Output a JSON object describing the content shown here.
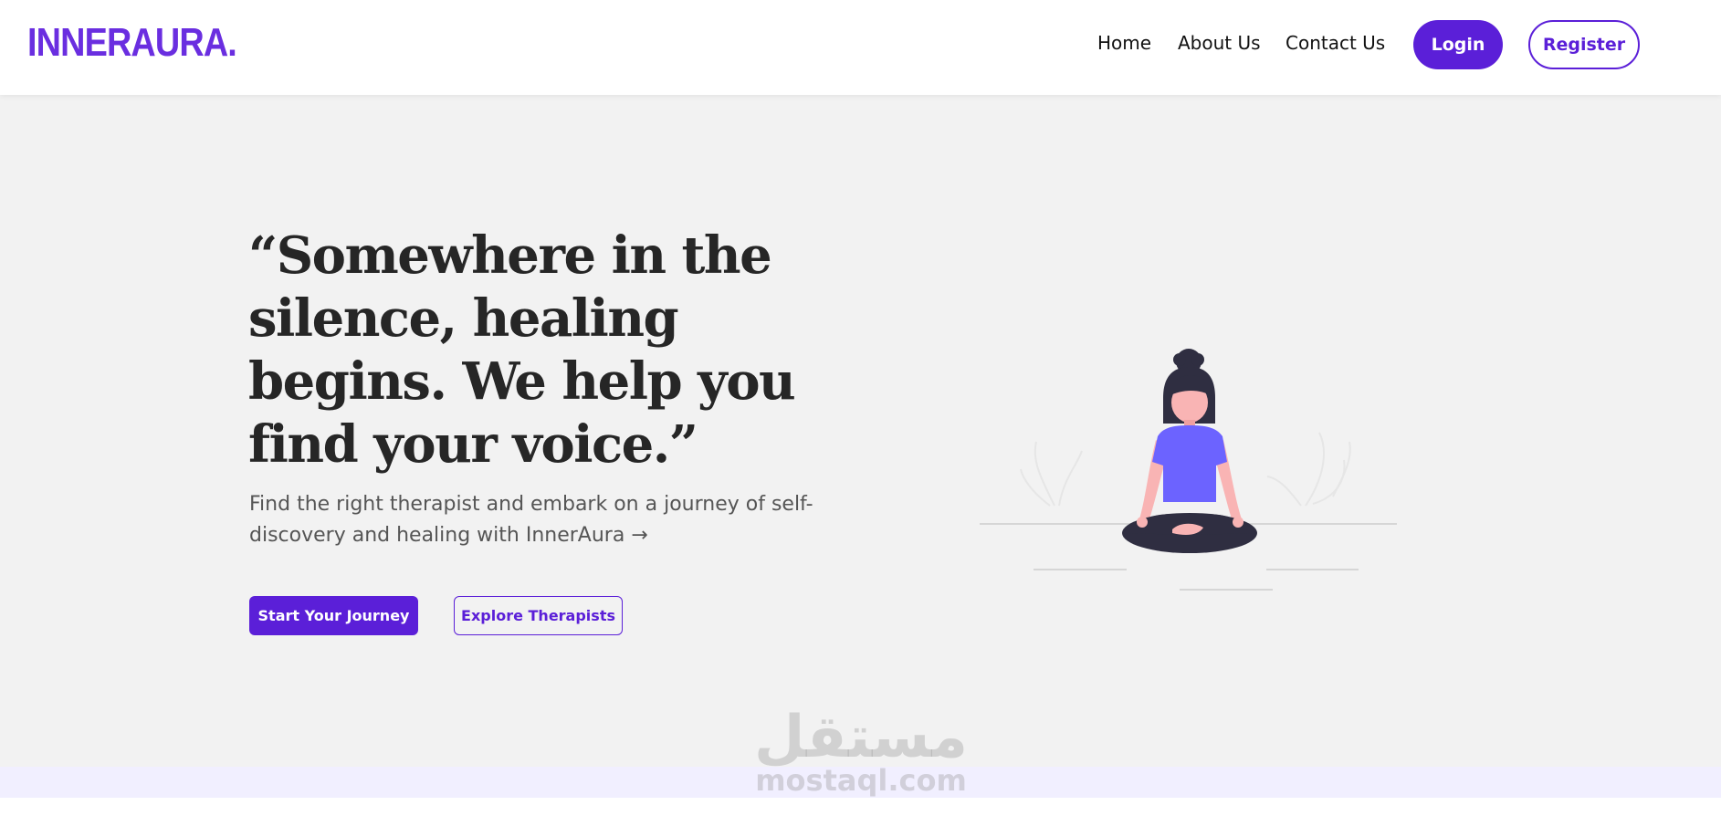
{
  "brand": {
    "logo_text": "INNERAURA.",
    "primary_color": "#5b1fd8",
    "logo_color": "#6a2ee0"
  },
  "nav": {
    "links": [
      {
        "label": "Home"
      },
      {
        "label": "About Us"
      },
      {
        "label": "Contact Us"
      }
    ],
    "login_label": "Login",
    "register_label": "Register"
  },
  "hero": {
    "quote": "“Somewhere in the silence, healing begins. We help you find your voice.”",
    "subtext": "Find the right therapist and embark on a journey of self-discovery and healing with InnerAura →",
    "primary_cta": "Start Your Journey",
    "secondary_cta": "Explore Therapists",
    "illustration": "meditating-person-icon"
  },
  "watermark": {
    "arabic": "مستقل",
    "latin": "mostaql.com"
  }
}
